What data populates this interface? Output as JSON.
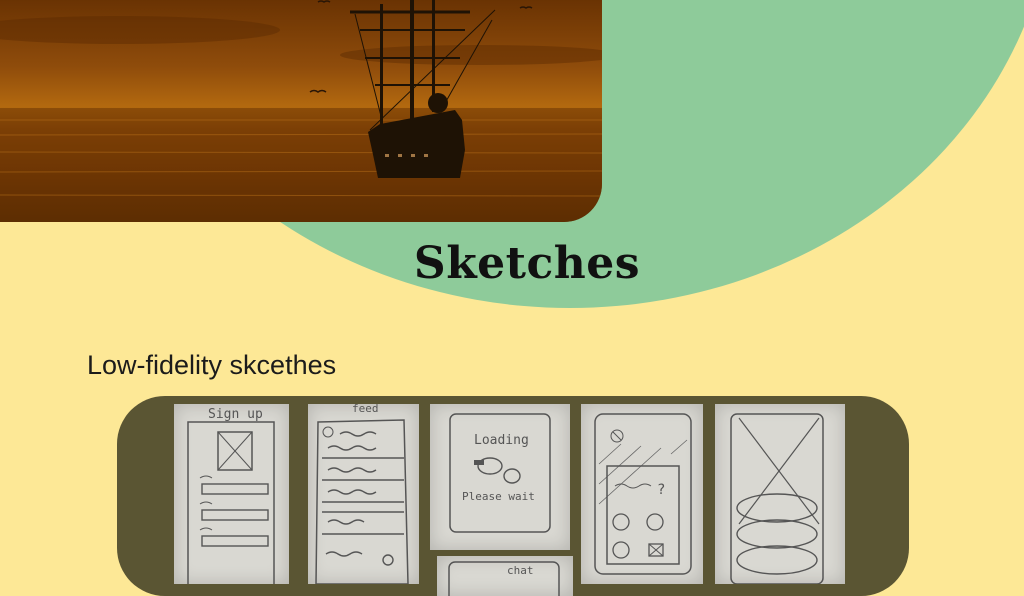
{
  "hero_image": {
    "icon": "ship-silhouette",
    "tint": "#9a5410"
  },
  "heading": {
    "title": "Sketches"
  },
  "section": {
    "subtitle": "Low-fidelity skcethes"
  },
  "sketches": {
    "signup": {
      "label": "Sign up"
    },
    "feed": {
      "label": "feed"
    },
    "loading": {
      "label": "Loading",
      "caption": "Please wait"
    },
    "game": {
      "label": ""
    },
    "shapes": {
      "label": ""
    },
    "chat": {
      "label": "chat"
    }
  },
  "colors": {
    "background": "#fde896",
    "blob": "#8ecb9a",
    "panel": "#5a5533",
    "paper": "#d9d8d2"
  }
}
